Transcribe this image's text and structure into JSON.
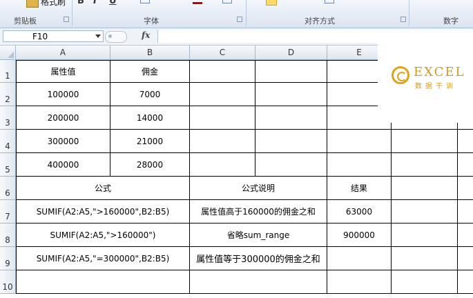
{
  "ribbon": {
    "format_painter": "格式刷",
    "glyphs": [
      "B",
      "I",
      "U"
    ],
    "group_labels": [
      "剪贴板",
      "字体",
      "对齐方式",
      "数字"
    ]
  },
  "formula_bar": {
    "name_box": "F10",
    "fx": "fx",
    "content": ""
  },
  "columns": [
    "A",
    "B",
    "C",
    "D",
    "E"
  ],
  "rows": [
    "1",
    "2",
    "3",
    "4",
    "5",
    "6",
    "7",
    "8",
    "9",
    "10"
  ],
  "cells": {
    "r1": {
      "a": "属性值",
      "b": "佣金"
    },
    "r2": {
      "a": "100000",
      "b": "7000"
    },
    "r3": {
      "a": "200000",
      "b": "14000"
    },
    "r4": {
      "a": "300000",
      "b": "21000"
    },
    "r5": {
      "a": "400000",
      "b": "28000"
    },
    "r6": {
      "ab": "公式",
      "cd": "公式说明",
      "e": "结果"
    },
    "r7": {
      "ab": "SUMIF(A2:A5,\">160000\",B2:B5)",
      "cd": "属性值高于160000的佣金之和",
      "e": "63000"
    },
    "r8": {
      "ab": "SUMIF(A2:A5,\">160000\")",
      "cd": "省略sum_range",
      "e": "900000"
    },
    "r9": {
      "ab": "SUMIF(A2:A5,\"=300000\",B2:B5)",
      "cd": "属性值等于300000的佣金之和",
      "e": ""
    }
  },
  "logo": {
    "name": "EXCEL",
    "sub": "数据干训"
  }
}
